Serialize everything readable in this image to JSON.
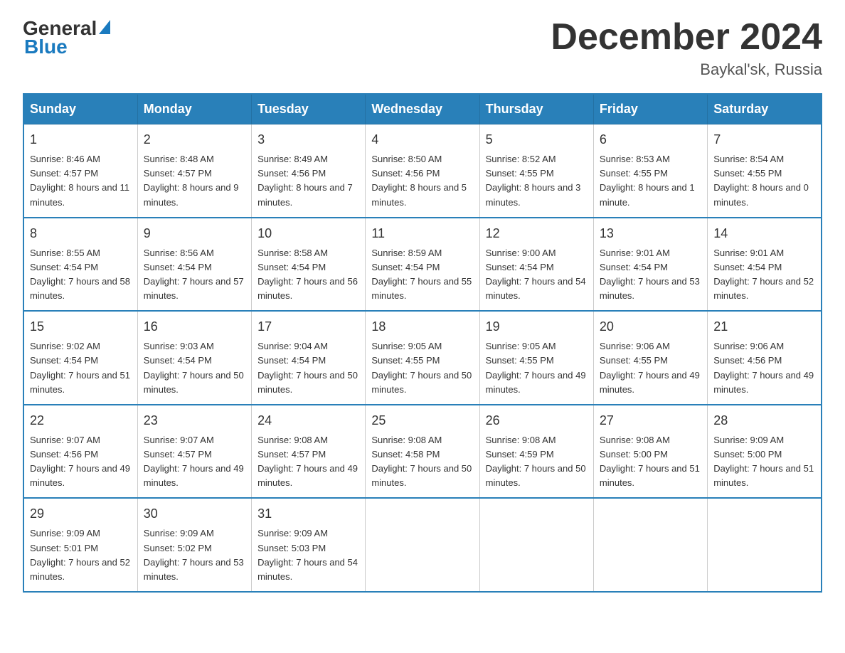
{
  "header": {
    "logo_general": "General",
    "logo_blue": "Blue",
    "month_title": "December 2024",
    "location": "Baykal'sk, Russia"
  },
  "calendar": {
    "days_of_week": [
      "Sunday",
      "Monday",
      "Tuesday",
      "Wednesday",
      "Thursday",
      "Friday",
      "Saturday"
    ],
    "weeks": [
      [
        {
          "day": "1",
          "sunrise": "8:46 AM",
          "sunset": "4:57 PM",
          "daylight": "8 hours and 11 minutes."
        },
        {
          "day": "2",
          "sunrise": "8:48 AM",
          "sunset": "4:57 PM",
          "daylight": "8 hours and 9 minutes."
        },
        {
          "day": "3",
          "sunrise": "8:49 AM",
          "sunset": "4:56 PM",
          "daylight": "8 hours and 7 minutes."
        },
        {
          "day": "4",
          "sunrise": "8:50 AM",
          "sunset": "4:56 PM",
          "daylight": "8 hours and 5 minutes."
        },
        {
          "day": "5",
          "sunrise": "8:52 AM",
          "sunset": "4:55 PM",
          "daylight": "8 hours and 3 minutes."
        },
        {
          "day": "6",
          "sunrise": "8:53 AM",
          "sunset": "4:55 PM",
          "daylight": "8 hours and 1 minute."
        },
        {
          "day": "7",
          "sunrise": "8:54 AM",
          "sunset": "4:55 PM",
          "daylight": "8 hours and 0 minutes."
        }
      ],
      [
        {
          "day": "8",
          "sunrise": "8:55 AM",
          "sunset": "4:54 PM",
          "daylight": "7 hours and 58 minutes."
        },
        {
          "day": "9",
          "sunrise": "8:56 AM",
          "sunset": "4:54 PM",
          "daylight": "7 hours and 57 minutes."
        },
        {
          "day": "10",
          "sunrise": "8:58 AM",
          "sunset": "4:54 PM",
          "daylight": "7 hours and 56 minutes."
        },
        {
          "day": "11",
          "sunrise": "8:59 AM",
          "sunset": "4:54 PM",
          "daylight": "7 hours and 55 minutes."
        },
        {
          "day": "12",
          "sunrise": "9:00 AM",
          "sunset": "4:54 PM",
          "daylight": "7 hours and 54 minutes."
        },
        {
          "day": "13",
          "sunrise": "9:01 AM",
          "sunset": "4:54 PM",
          "daylight": "7 hours and 53 minutes."
        },
        {
          "day": "14",
          "sunrise": "9:01 AM",
          "sunset": "4:54 PM",
          "daylight": "7 hours and 52 minutes."
        }
      ],
      [
        {
          "day": "15",
          "sunrise": "9:02 AM",
          "sunset": "4:54 PM",
          "daylight": "7 hours and 51 minutes."
        },
        {
          "day": "16",
          "sunrise": "9:03 AM",
          "sunset": "4:54 PM",
          "daylight": "7 hours and 50 minutes."
        },
        {
          "day": "17",
          "sunrise": "9:04 AM",
          "sunset": "4:54 PM",
          "daylight": "7 hours and 50 minutes."
        },
        {
          "day": "18",
          "sunrise": "9:05 AM",
          "sunset": "4:55 PM",
          "daylight": "7 hours and 50 minutes."
        },
        {
          "day": "19",
          "sunrise": "9:05 AM",
          "sunset": "4:55 PM",
          "daylight": "7 hours and 49 minutes."
        },
        {
          "day": "20",
          "sunrise": "9:06 AM",
          "sunset": "4:55 PM",
          "daylight": "7 hours and 49 minutes."
        },
        {
          "day": "21",
          "sunrise": "9:06 AM",
          "sunset": "4:56 PM",
          "daylight": "7 hours and 49 minutes."
        }
      ],
      [
        {
          "day": "22",
          "sunrise": "9:07 AM",
          "sunset": "4:56 PM",
          "daylight": "7 hours and 49 minutes."
        },
        {
          "day": "23",
          "sunrise": "9:07 AM",
          "sunset": "4:57 PM",
          "daylight": "7 hours and 49 minutes."
        },
        {
          "day": "24",
          "sunrise": "9:08 AM",
          "sunset": "4:57 PM",
          "daylight": "7 hours and 49 minutes."
        },
        {
          "day": "25",
          "sunrise": "9:08 AM",
          "sunset": "4:58 PM",
          "daylight": "7 hours and 50 minutes."
        },
        {
          "day": "26",
          "sunrise": "9:08 AM",
          "sunset": "4:59 PM",
          "daylight": "7 hours and 50 minutes."
        },
        {
          "day": "27",
          "sunrise": "9:08 AM",
          "sunset": "5:00 PM",
          "daylight": "7 hours and 51 minutes."
        },
        {
          "day": "28",
          "sunrise": "9:09 AM",
          "sunset": "5:00 PM",
          "daylight": "7 hours and 51 minutes."
        }
      ],
      [
        {
          "day": "29",
          "sunrise": "9:09 AM",
          "sunset": "5:01 PM",
          "daylight": "7 hours and 52 minutes."
        },
        {
          "day": "30",
          "sunrise": "9:09 AM",
          "sunset": "5:02 PM",
          "daylight": "7 hours and 53 minutes."
        },
        {
          "day": "31",
          "sunrise": "9:09 AM",
          "sunset": "5:03 PM",
          "daylight": "7 hours and 54 minutes."
        },
        null,
        null,
        null,
        null
      ]
    ]
  },
  "labels": {
    "sunrise_prefix": "Sunrise: ",
    "sunset_prefix": "Sunset: ",
    "daylight_prefix": "Daylight: "
  }
}
